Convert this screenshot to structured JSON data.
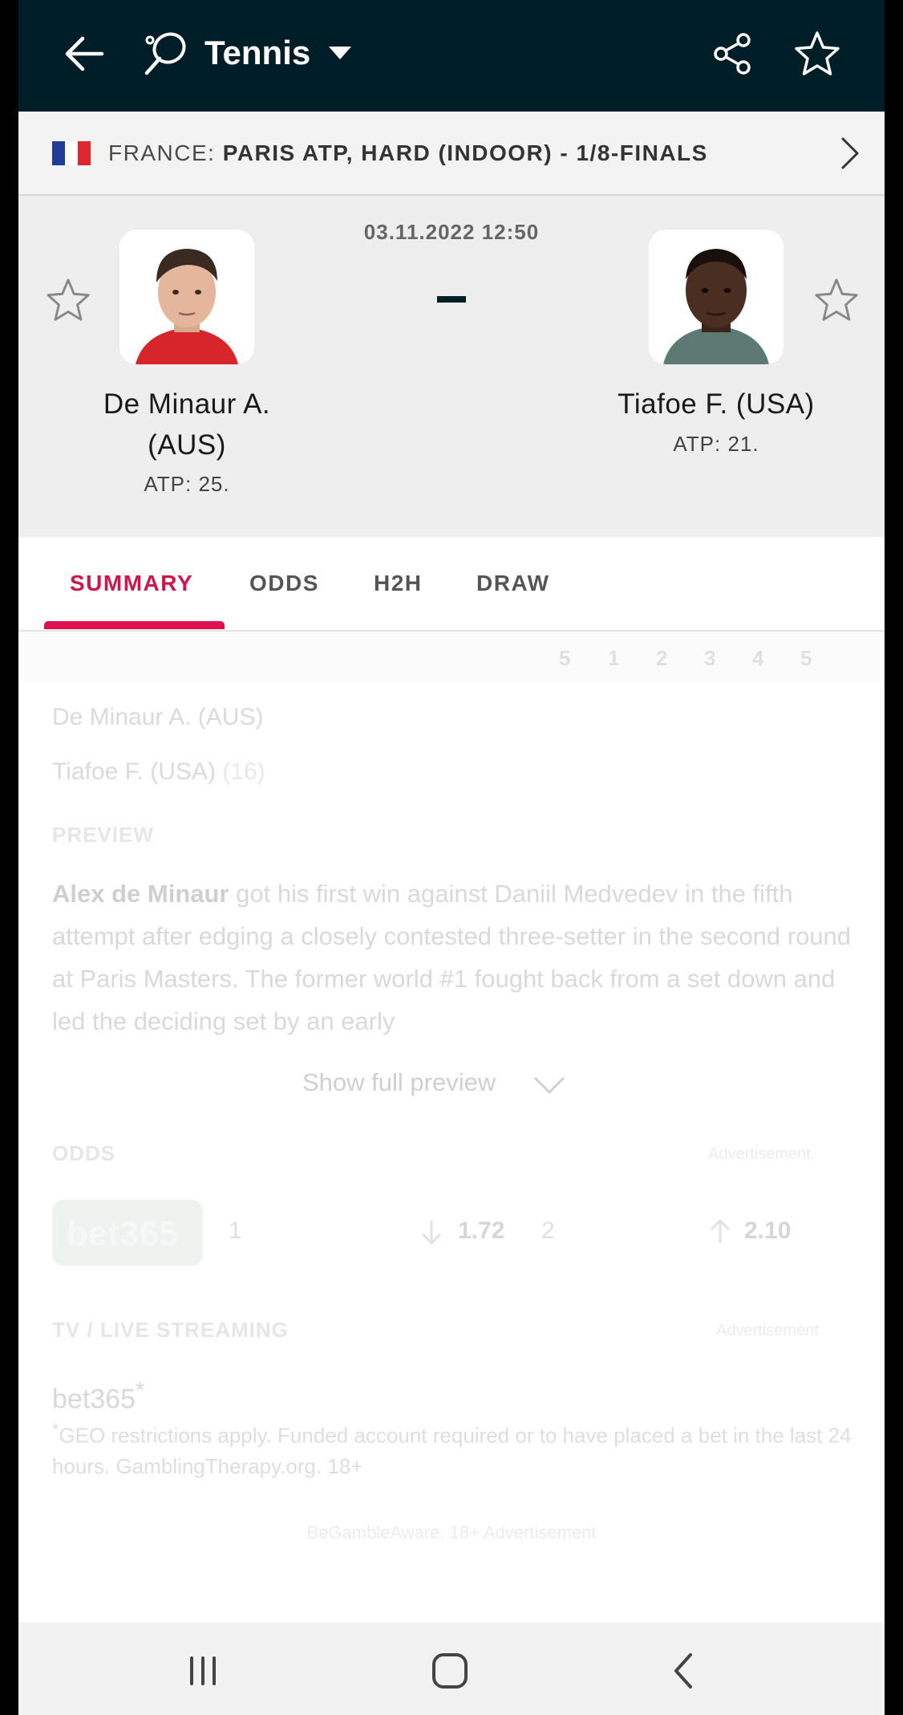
{
  "topbar": {
    "sport": "Tennis",
    "icons": [
      "back-arrow-icon",
      "tennis-racket-icon",
      "dropdown-caret-icon",
      "share-icon",
      "star-icon"
    ]
  },
  "breadcrumb": {
    "country": "FRANCE:",
    "competition": "PARIS ATP, HARD (INDOOR) - 1/8-FINALS",
    "flag_colors": [
      "#1f3d96",
      "#ffffff",
      "#e0272e"
    ]
  },
  "match": {
    "datetime": "03.11.2022 12:50",
    "score": "-",
    "home": {
      "name": "De Minaur A. (AUS)",
      "rank": "ATP: 25."
    },
    "away": {
      "name": "Tiafoe F. (USA)",
      "rank": "ATP: 21."
    }
  },
  "tabs": [
    "SUMMARY",
    "ODDS",
    "H2H",
    "DRAW"
  ],
  "active_tab": "SUMMARY",
  "summary": {
    "set_columns": [
      "5",
      "1",
      "2",
      "3",
      "4",
      "5"
    ],
    "player1": "De Minaur A. (AUS)",
    "player2": "Tiafoe F. (USA)",
    "player2_seed": "(16)",
    "preview_title": "PREVIEW",
    "preview_bold": "Alex de Minaur",
    "preview_text": " got his first win against Daniil Medvedev in the fifth attempt after edging a closely contested three-setter in the second round at Paris Masters. The former world #1 fought back from a set down and led the deciding set by an early",
    "show_full": "Show full preview",
    "odds_title": "ODDS",
    "odds_adv": "Advertisement",
    "bookmaker": "bet365",
    "odds": [
      {
        "label": "1",
        "value": "1.72",
        "trend": "down"
      },
      {
        "label": "2",
        "value": "2.10",
        "trend": "up"
      }
    ],
    "tv_title": "TV / LIVE STREAMING",
    "tv_adv": "Advertisement",
    "tv_bookmaker": "bet365",
    "tv_asterisk": "*",
    "geo_asterisk": "*",
    "geo_text": "GEO restrictions apply. Funded account required or to have placed a bet in the last 24 hours. GamblingTherapy.org. 18+",
    "gamble_text": "BeGambleAware. 18+ Advertisement"
  },
  "colors": {
    "topbar": "#001e28",
    "accent": "#e0104d"
  }
}
